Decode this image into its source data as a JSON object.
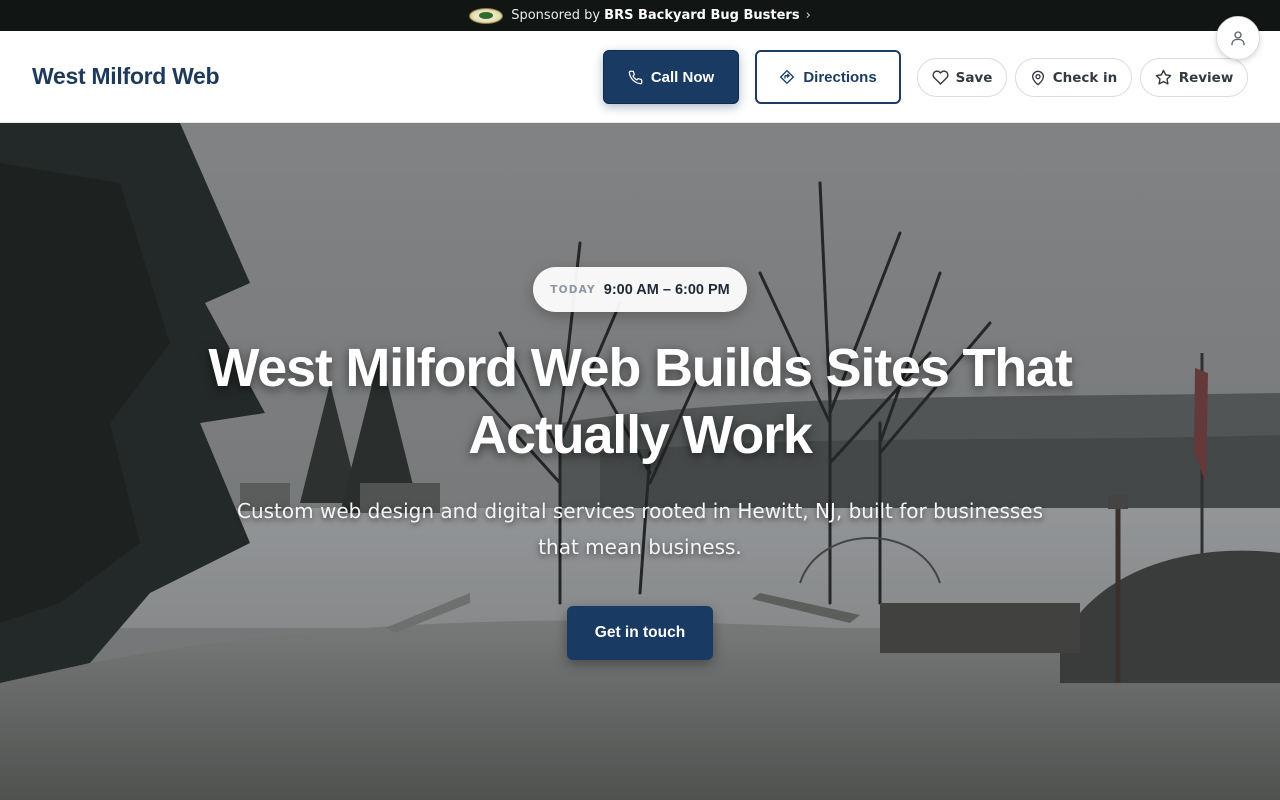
{
  "sponsor": {
    "prefix": "Sponsored by",
    "name": "BRS Backyard Bug Busters",
    "chevron": "›"
  },
  "header": {
    "brand": "West Milford Web",
    "call_label": "Call Now",
    "directions_label": "Directions",
    "save_label": "Save",
    "checkin_label": "Check in",
    "review_label": "Review"
  },
  "hero": {
    "hours_label": "TODAY",
    "hours_value": "9:00 AM – 6:00 PM",
    "headline_line1": "West Milford Web Builds Sites That",
    "headline_line2": "Actually Work",
    "subhead_line1": "Custom web design and digital services rooted in Hewitt, NJ, built for businesses",
    "subhead_line2": "that mean business.",
    "cta_label": "Get in touch"
  },
  "icons": {
    "call": "phone-icon",
    "directions": "directions-icon",
    "save": "heart-icon",
    "checkin": "map-pin-icon",
    "review": "star-icon",
    "profile": "user-icon"
  },
  "colors": {
    "brand_navy": "#183a63",
    "sponsor_bar": "#111514",
    "brand_text": "#1d3a5b"
  }
}
